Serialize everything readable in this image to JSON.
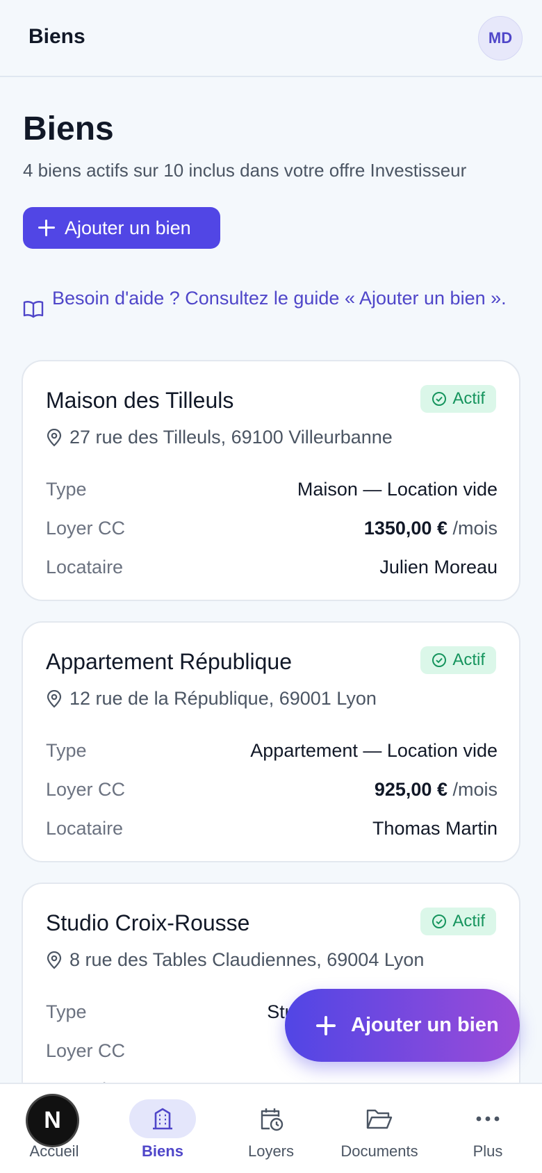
{
  "header": {
    "title": "Biens",
    "avatar_initials": "MD"
  },
  "page": {
    "title": "Biens",
    "subtitle": "4 biens actifs sur 10 inclus dans votre offre Investisseur",
    "add_button": "Ajouter un bien",
    "help_text": "Besoin d'aide ? Consultez le guide « Ajouter un bien »."
  },
  "labels": {
    "type": "Type",
    "rent": "Loyer CC",
    "tenant": "Locataire",
    "per_month": "/mois"
  },
  "properties": [
    {
      "name": "Maison des Tilleuls",
      "status": "Actif",
      "address": "27 rue des Tilleuls, 69100 Villeurbanne",
      "type": "Maison — Location vide",
      "rent": "1350,00 €",
      "tenant": "Julien Moreau"
    },
    {
      "name": "Appartement République",
      "status": "Actif",
      "address": "12 rue de la République, 69001 Lyon",
      "type": "Appartement — Location vide",
      "rent": "925,00 €",
      "tenant": "Thomas Martin"
    },
    {
      "name": "Studio Croix-Rousse",
      "status": "Actif",
      "address": "8 rue des Tables Claudiennes, 69004 Lyon",
      "type": "Studio — Location meublée",
      "rent": "",
      "tenant": ""
    }
  ],
  "fab": {
    "label": "Ajouter un bien"
  },
  "nav": {
    "items": [
      {
        "label": "Accueil",
        "icon": "home-icon"
      },
      {
        "label": "Biens",
        "icon": "building-icon"
      },
      {
        "label": "Loyers",
        "icon": "calendar-clock-icon"
      },
      {
        "label": "Documents",
        "icon": "folder-icon"
      },
      {
        "label": "Plus",
        "icon": "more-icon"
      }
    ],
    "active": "Biens"
  },
  "overlay_badge": "N",
  "colors": {
    "accent": "#5146e5",
    "accent_text": "#4f46c9",
    "success_bg": "#dbf7e9",
    "success_text": "#15945d",
    "background": "#f4f8fc"
  }
}
